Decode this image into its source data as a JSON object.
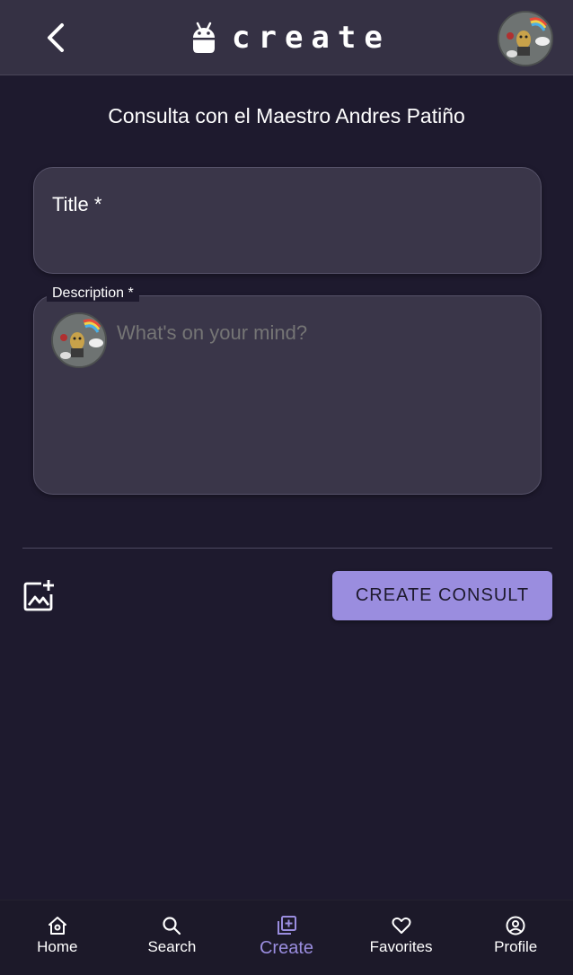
{
  "header": {
    "brand_text": "create",
    "icons": [
      "back-arrow-icon",
      "android-icon",
      "avatar"
    ]
  },
  "subtitle": "Consulta con el Maestro Andres Patiño",
  "form": {
    "title_label": "Title *",
    "description_label": "Description *",
    "description_placeholder": "What's on your mind?",
    "add_image_icon": "add-photo-icon",
    "submit_label": "CREATE CONSULT"
  },
  "nav": {
    "items": [
      {
        "label": "Home",
        "icon": "home-icon"
      },
      {
        "label": "Search",
        "icon": "search-icon"
      },
      {
        "label": "Create",
        "icon": "add-box-icon",
        "active": true
      },
      {
        "label": "Favorites",
        "icon": "heart-icon"
      },
      {
        "label": "Profile",
        "icon": "account-circle-icon"
      }
    ]
  },
  "colors": {
    "background": "#1e1a2e",
    "topbar": "#353144",
    "field": "#3a3649",
    "accent": "#9a8ddf"
  }
}
